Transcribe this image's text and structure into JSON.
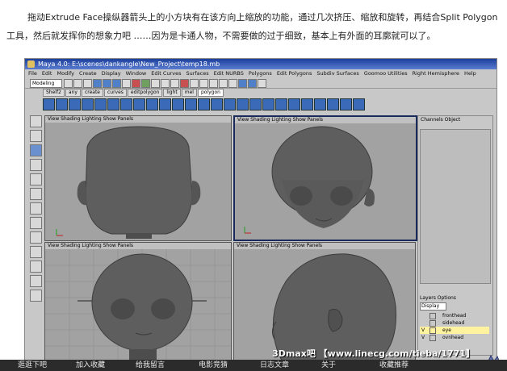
{
  "intro_text": "拖动Extrude Face操纵器箭头上的小方块有在该方向上缩放的功能，通过几次挤压、缩放和旋转，再结合Split Polygon工具，然后就发挥你的想象力吧 ……因为是卡通人物，不需要做的过于细致，基本上有外面的耳廓就可以了。",
  "maya": {
    "title": "Maya 4.0: E:\\scenes\\dankangle\\New_Project\\temp18.mb",
    "menu": [
      "File",
      "Edit",
      "Modify",
      "Create",
      "Display",
      "Window",
      "Edit Curves",
      "Surfaces",
      "Edit NURBS",
      "Polygons",
      "Edit Polygons",
      "Subdiv Surfaces",
      "Goomoo Utilities",
      "Right Hemisphere",
      "Help"
    ],
    "mode": "Modeling",
    "shelf_tabs": [
      "Shelf2",
      "any",
      "create",
      "curves",
      "editpolygon",
      "light",
      "mel",
      "polygon"
    ],
    "viewport_menu": "View  Shading  Lighting  Show  Panels",
    "right_panel": {
      "header": "Channels  Object",
      "layers_header": "Layers  Options",
      "display_option": "Display",
      "layers": [
        {
          "check": "",
          "name": "fronthead"
        },
        {
          "check": "",
          "name": "sidehead"
        },
        {
          "check": "V",
          "name": "eye"
        },
        {
          "check": "V",
          "name": "ovnhead"
        }
      ]
    }
  },
  "watermark": "3Dmax吧 【www.linecg.com/tieba/1771】",
  "bottom_bar": [
    "逛逛下吧",
    "加入收藏",
    "给我留言",
    "电影竞猜",
    "日志文章",
    "关于",
    "收藏推荐"
  ],
  "colors": {
    "title_bar": "#1c3f9c",
    "viewport_bg": "#a2a2a2",
    "head_fill": "#5e5e5e",
    "bottom_bar": "#2b2b2b"
  }
}
